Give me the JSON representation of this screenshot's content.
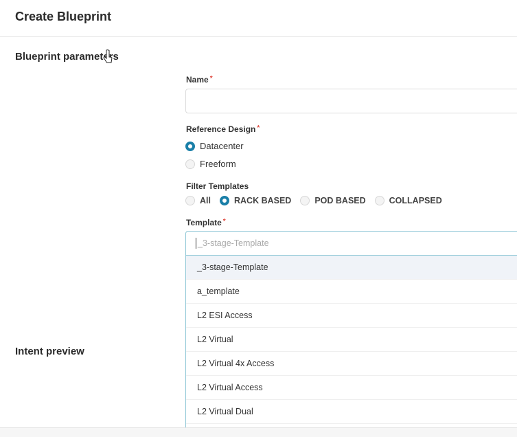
{
  "header": {
    "title": "Create Blueprint"
  },
  "sections": {
    "params_title": "Blueprint parameters",
    "intent_title": "Intent preview"
  },
  "form": {
    "name": {
      "label": "Name",
      "required_mark": "*",
      "value": ""
    },
    "reference_design": {
      "label": "Reference Design",
      "required_mark": "*",
      "options": [
        "Datacenter",
        "Freeform"
      ],
      "selected": "Datacenter"
    },
    "filter_templates": {
      "label": "Filter Templates",
      "options": [
        "All",
        "RACK BASED",
        "POD BASED",
        "COLLAPSED"
      ],
      "selected": "RACK BASED"
    },
    "template": {
      "label": "Template",
      "required_mark": "*",
      "placeholder": "_3-stage-Template",
      "options": [
        "_3-stage-Template",
        "a_template",
        "L2 ESI Access",
        "L2 Virtual",
        "L2 Virtual 4x Access",
        "L2 Virtual Access",
        "L2 Virtual Dual"
      ],
      "highlighted": "_3-stage-Template"
    }
  },
  "colors": {
    "accent": "#1a7fa8",
    "required": "#e0483e",
    "highlight_row": "#f0f3f8"
  }
}
